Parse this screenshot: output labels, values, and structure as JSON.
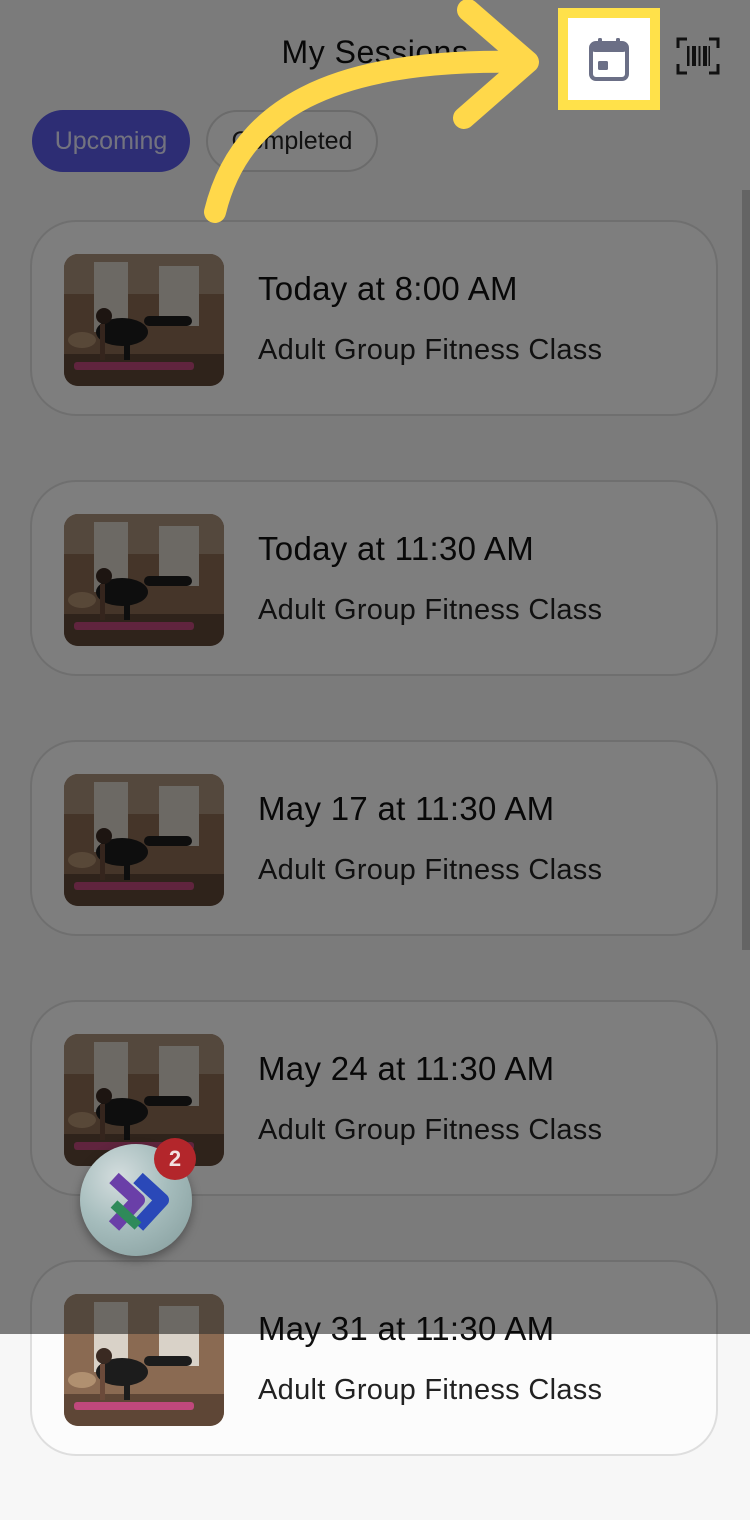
{
  "header": {
    "title": "My Sessions"
  },
  "tabs": [
    {
      "label": "Upcoming",
      "active": true
    },
    {
      "label": "Completed",
      "active": false
    }
  ],
  "sessions": [
    {
      "time": "Today at 8:00 AM",
      "name": "Adult Group Fitness Class"
    },
    {
      "time": "Today at 11:30 AM",
      "name": "Adult Group Fitness Class"
    },
    {
      "time": "May 17 at 11:30 AM",
      "name": "Adult Group Fitness Class"
    },
    {
      "time": "May 24 at 11:30 AM",
      "name": "Adult Group Fitness Class"
    },
    {
      "time": "May 31 at 11:30 AM",
      "name": "Adult Group Fitness Class"
    }
  ],
  "icons": {
    "calendar": "calendar-icon",
    "scan": "barcode-scan-icon",
    "arrow": "curved-arrow-pointer",
    "fab": "assistant-launcher-icon"
  },
  "fab_badge": "2",
  "colors": {
    "accent": "#5a5ae8",
    "highlight": "#ffe14a",
    "arrow": "#ffd84a",
    "badge": "#b3262b"
  }
}
